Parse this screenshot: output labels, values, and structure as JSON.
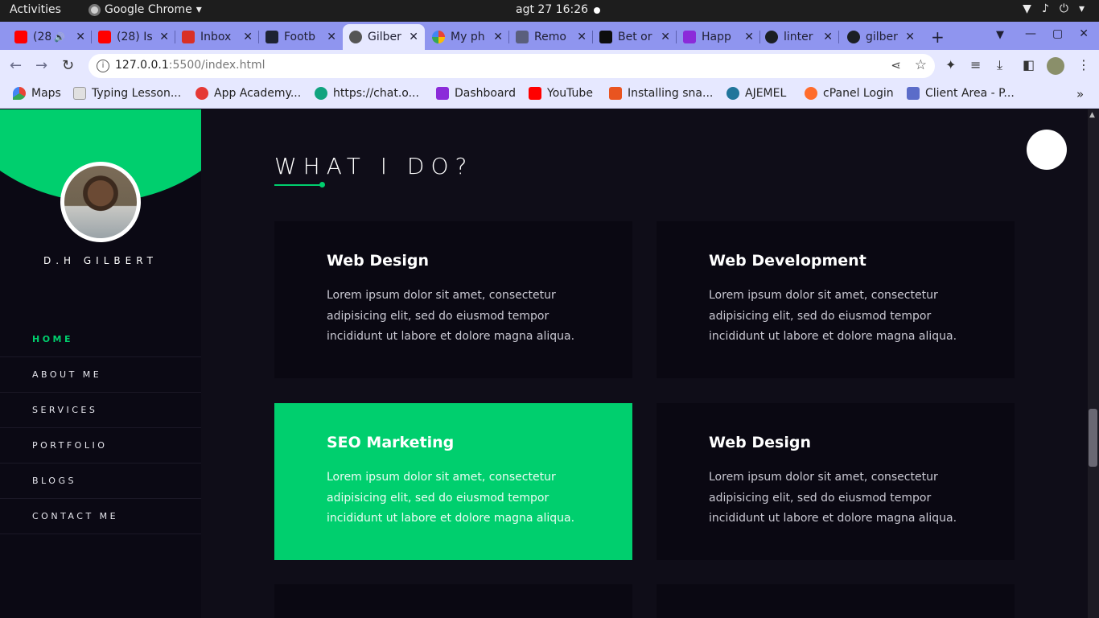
{
  "os": {
    "activities": "Activities",
    "app_name": "Google Chrome",
    "clock": "agt 27  16:26"
  },
  "tabs": [
    {
      "title": "(28",
      "favicon": "youtube-icon",
      "color": "#ff0000"
    },
    {
      "title": "(28) Is",
      "favicon": "youtube-icon",
      "color": "#ff0000"
    },
    {
      "title": "Inbox",
      "favicon": "gmail-icon",
      "color": "#d93025"
    },
    {
      "title": "Footb",
      "favicon": "football-icon",
      "color": "#1d2333"
    },
    {
      "title": "Gilber",
      "favicon": "globe-icon",
      "color": "#555555",
      "active": true
    },
    {
      "title": "My ph",
      "favicon": "photos-icon",
      "color": "#fbbc04"
    },
    {
      "title": "Remo",
      "favicon": "layers-icon",
      "color": "#5a5f7d"
    },
    {
      "title": "Bet or",
      "favicon": "bet-icon",
      "color": "#0d0d0d"
    },
    {
      "title": "Happ",
      "favicon": "happ-icon",
      "color": "#8b2bd9"
    },
    {
      "title": "linter",
      "favicon": "github-icon",
      "color": "#1b1f23"
    },
    {
      "title": "gilber",
      "favicon": "github-icon",
      "color": "#1b1f23"
    }
  ],
  "address": {
    "host": "127.0.0.1",
    "path": ":5500/index.html"
  },
  "bookmarks": [
    {
      "label": "Maps",
      "favicon": "maps-icon",
      "color": "#34a853"
    },
    {
      "label": "Typing Lesson...",
      "favicon": "typing-icon",
      "color": "#e0e0e0"
    },
    {
      "label": "App Academy...",
      "favicon": "app-academy-icon",
      "color": "#e53935"
    },
    {
      "label": "https://chat.o...",
      "favicon": "chat-icon",
      "color": "#10a37f"
    },
    {
      "label": "Dashboard",
      "favicon": "dashboard-icon",
      "color": "#8b2bd9"
    },
    {
      "label": "YouTube",
      "favicon": "youtube-icon",
      "color": "#ff0000"
    },
    {
      "label": "Installing sna...",
      "favicon": "snap-icon",
      "color": "#e95420"
    },
    {
      "label": "AJEMEL",
      "favicon": "wordpress-icon",
      "color": "#21759b"
    },
    {
      "label": "cPanel Login",
      "favicon": "cpanel-icon",
      "color": "#ff6c2c"
    },
    {
      "label": "Client Area - P...",
      "favicon": "client-area-icon",
      "color": "#5b6cc9"
    }
  ],
  "page": {
    "site_name": "D.H GILBERT",
    "nav": [
      {
        "label": "HOME",
        "active": true
      },
      {
        "label": "ABOUT ME"
      },
      {
        "label": "SERVICES"
      },
      {
        "label": "PORTFOLIO"
      },
      {
        "label": "BLOGS"
      },
      {
        "label": "CONTACT ME"
      }
    ],
    "section_title": "WHAT I DO?",
    "services": [
      {
        "title": "Web Design",
        "text": "Lorem ipsum dolor sit amet, consectetur adipisicing elit, sed do eiusmod tempor incididunt ut labore et dolore magna aliqua."
      },
      {
        "title": "Web Development",
        "text": "Lorem ipsum dolor sit amet, consectetur adipisicing elit, sed do eiusmod tempor incididunt ut labore et dolore magna aliqua."
      },
      {
        "title": "SEO Marketing",
        "text": "Lorem ipsum dolor sit amet, consectetur adipisicing elit, sed do eiusmod tempor incididunt ut labore et dolore magna aliqua.",
        "highlight": true
      },
      {
        "title": "Web Design",
        "text": "Lorem ipsum dolor sit amet, consectetur adipisicing elit, sed do eiusmod tempor incididunt ut labore et dolore magna aliqua."
      }
    ]
  },
  "colors": {
    "accent": "#00cf6e",
    "page_bg": "#0f0d18",
    "card_bg": "#0a0812",
    "tab_strip": "#8f95ef"
  }
}
